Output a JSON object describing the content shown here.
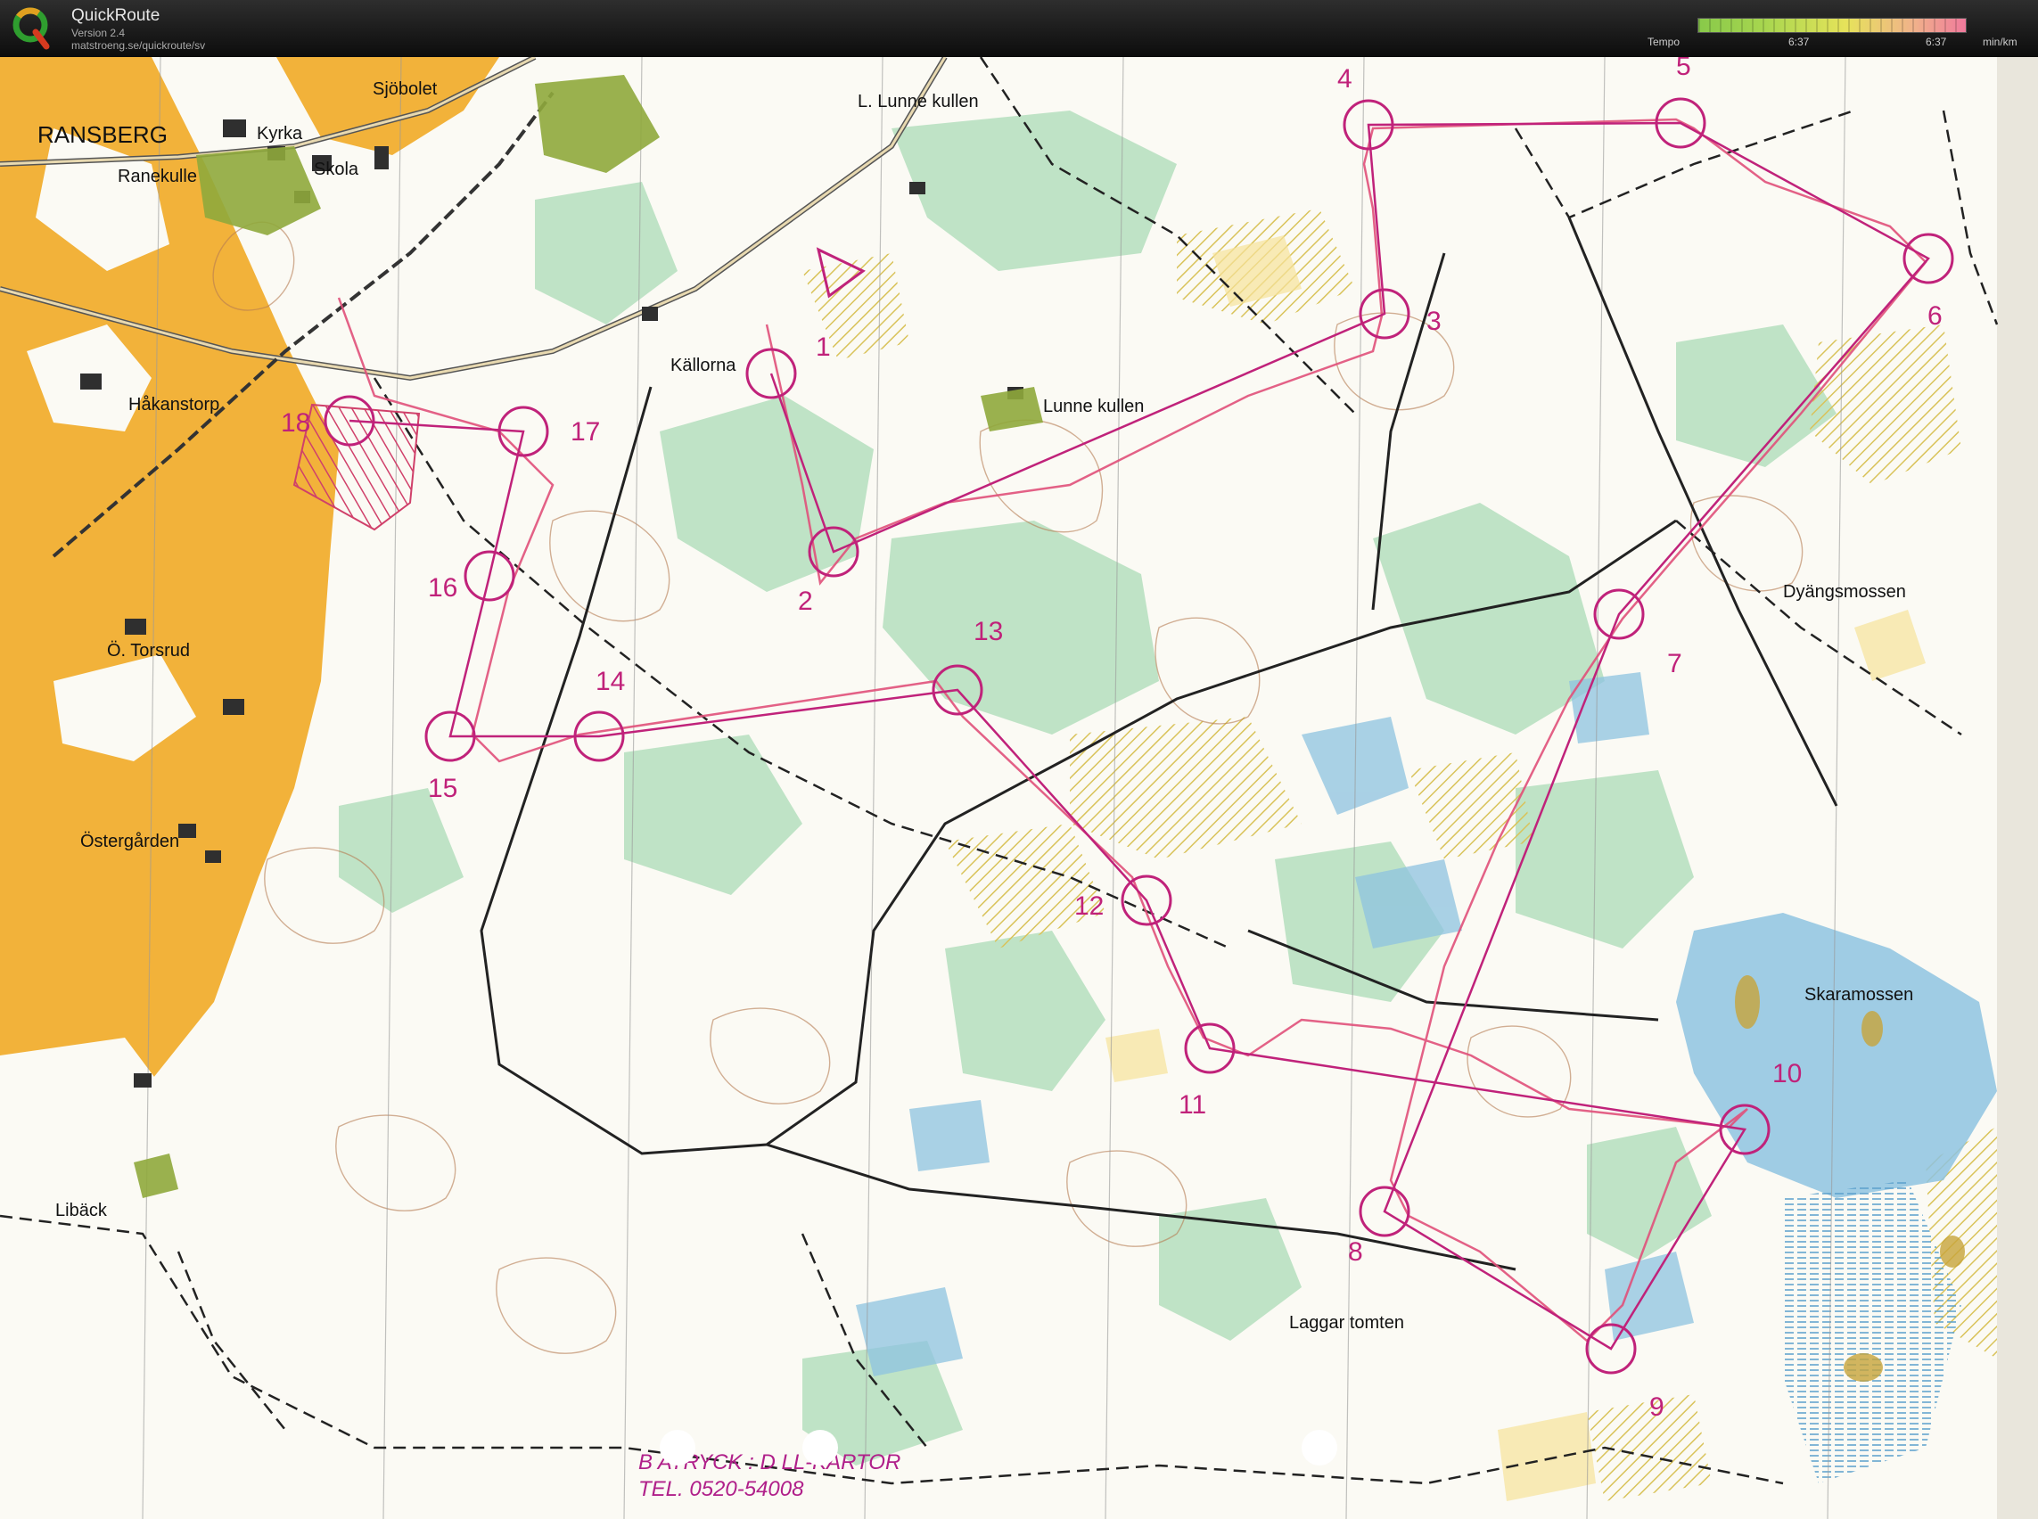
{
  "app": {
    "name": "QuickRoute",
    "version": "Version 2.4",
    "url": "matstroeng.se/quickroute/sv"
  },
  "legend": {
    "label": "Tempo",
    "min": "6:37",
    "max": "6:37",
    "unit": "min/km"
  },
  "colors": {
    "course": "#c0227a",
    "route": "#e0507a",
    "forest_green": "#bfe3c6",
    "open_yellow": "#f2b23a",
    "rough_yellow": "#f6e29a",
    "marsh_blue": "#8ec3e0"
  },
  "place_names": [
    "RANSBERG",
    "Sjöbolet",
    "Kyrka",
    "Skola",
    "Ranekulle",
    "L. Lunne kullen",
    "Källorna",
    "Håkanstorp",
    "Lunne kullen",
    "Ö. Torsrud",
    "Östergården",
    "Libäck",
    "Dyängsmossen",
    "Skaramossen",
    "Laggar tomten"
  ],
  "controls": [
    {
      "number": "1"
    },
    {
      "number": "2"
    },
    {
      "number": "3"
    },
    {
      "number": "4"
    },
    {
      "number": "5"
    },
    {
      "number": "6"
    },
    {
      "number": "7"
    },
    {
      "number": "8"
    },
    {
      "number": "9"
    },
    {
      "number": "10"
    },
    {
      "number": "11"
    },
    {
      "number": "12"
    },
    {
      "number": "13"
    },
    {
      "number": "14"
    },
    {
      "number": "15"
    },
    {
      "number": "16"
    },
    {
      "number": "17"
    },
    {
      "number": "18"
    }
  ],
  "printer": {
    "line1": "B    ATRYCK : D    LL-KARTOR",
    "line2": "TEL. 0520-54008"
  }
}
